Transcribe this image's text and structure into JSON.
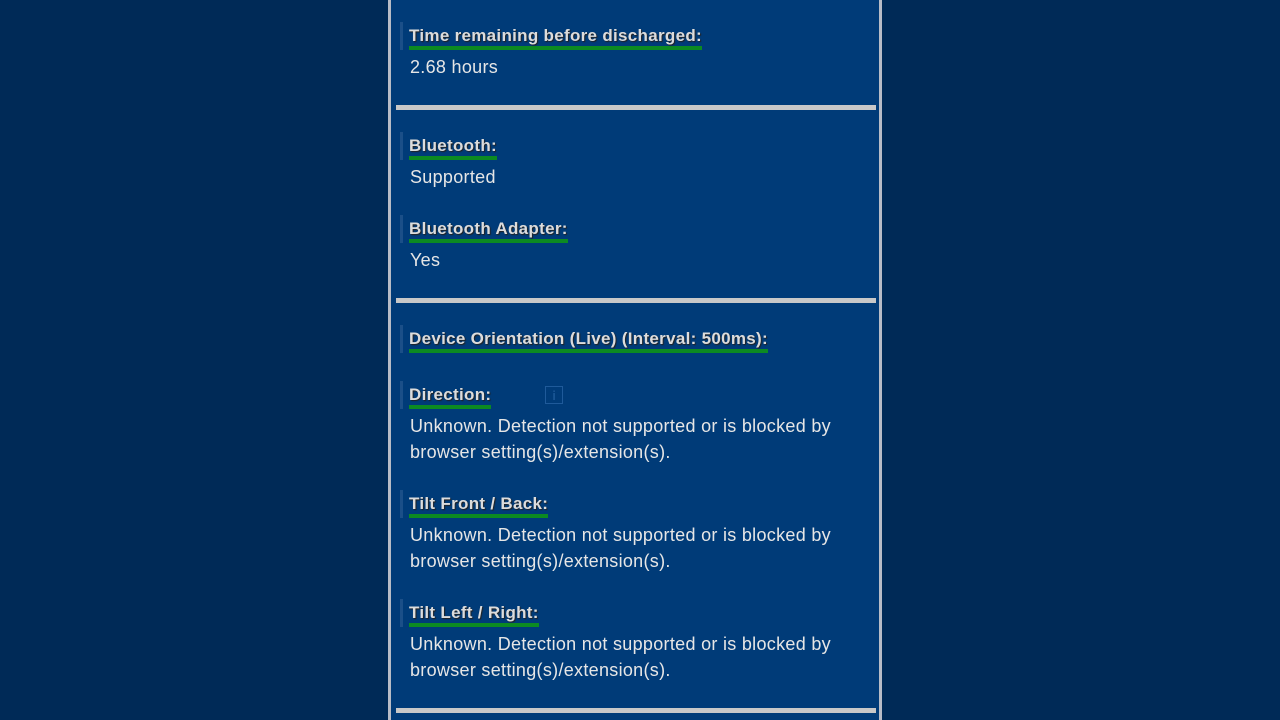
{
  "battery": {
    "time_label": "Time remaining before discharged:",
    "time_value": "2.68 hours"
  },
  "bluetooth": {
    "support_label": "Bluetooth:",
    "support_value": "Supported",
    "adapter_label": "Bluetooth Adapter:",
    "adapter_value": "Yes"
  },
  "orientation": {
    "heading": "Device Orientation (Live) (Interval: 500ms):",
    "info_button": "i",
    "direction_label": "Direction:",
    "direction_value": "Unknown. Detection not supported or is blocked by browser setting(s)/extension(s).",
    "tilt_fb_label": "Tilt Front / Back:",
    "tilt_fb_value": "Unknown. Detection not supported or is blocked by browser setting(s)/extension(s).",
    "tilt_lr_label": "Tilt Left / Right:",
    "tilt_lr_value": "Unknown. Detection not supported or is blocked by browser setting(s)/extension(s)."
  }
}
